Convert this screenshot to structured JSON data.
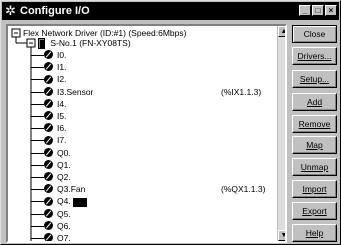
{
  "window": {
    "title": "Configure I/O",
    "icon": "gear-icon"
  },
  "titlebar_buttons": [
    "_",
    "□",
    "×"
  ],
  "tree": {
    "root_label": "Flex Network Driver (ID:#1) (Speed:6Mbps)",
    "station_label": "S-No.1  (FN-XY08TS)",
    "points": [
      {
        "label": "I0.",
        "address": ""
      },
      {
        "label": "I1.",
        "address": ""
      },
      {
        "label": "I2.",
        "address": ""
      },
      {
        "label": "I3.Sensor",
        "address": "(%IX1.1.3)"
      },
      {
        "label": "I4.",
        "address": ""
      },
      {
        "label": "I5.",
        "address": ""
      },
      {
        "label": "I6.",
        "address": ""
      },
      {
        "label": "I7.",
        "address": ""
      },
      {
        "label": "Q0.",
        "address": ""
      },
      {
        "label": "Q1.",
        "address": ""
      },
      {
        "label": "Q2.",
        "address": ""
      },
      {
        "label": "Q3.Fan",
        "address": "(%QX1.1.3)"
      },
      {
        "label": "Q4.",
        "address": ""
      },
      {
        "label": "Q5.",
        "address": ""
      },
      {
        "label": "Q6.",
        "address": ""
      },
      {
        "label": "Q7.",
        "address": ""
      }
    ],
    "expand_symbol": "−"
  },
  "scrollbar": {
    "up": "▲",
    "down": "▼"
  },
  "buttons": {
    "close": "Close",
    "drivers": "Drivers...",
    "setup": "Setup...",
    "add": "Add",
    "remove": "Remove",
    "map": "Map",
    "unmap": "Unmap",
    "import": "Import",
    "export": "Export",
    "help": "Help"
  }
}
